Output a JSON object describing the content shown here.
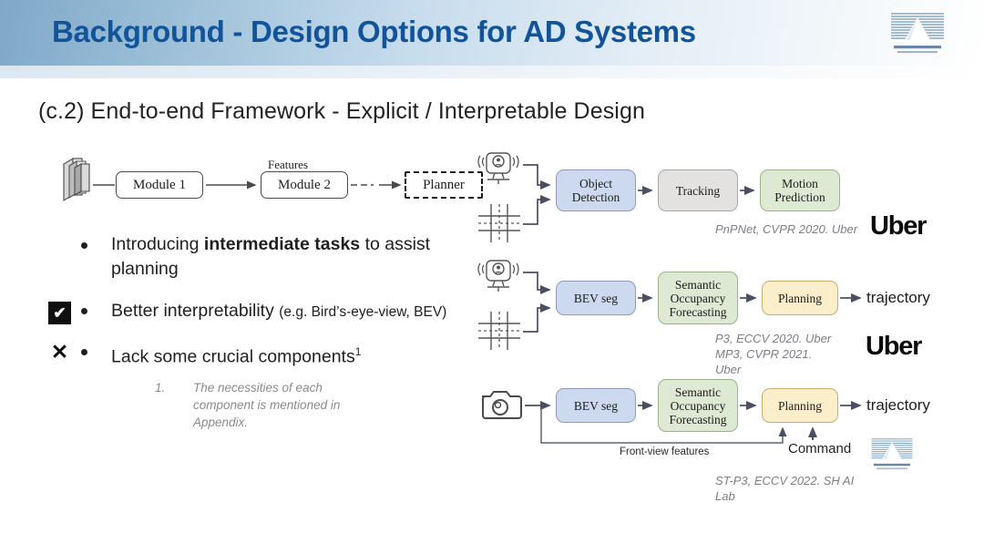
{
  "header": {
    "title": "Background - Design Options for AD Systems",
    "logo_name": "shanghai-ai-laboratory-logo",
    "accent_color": "#12549a"
  },
  "subtitle": "(c.2)  End-to-end Framework -  Explicit / Interpretable Design",
  "module_diagram": {
    "input_icon": "data-stack-icon",
    "module1": "Module 1",
    "features_label": "Features",
    "module2": "Module 2",
    "planner": "Planner"
  },
  "bullets": [
    {
      "marker": "",
      "text_before": "Introducing ",
      "text_bold": "intermediate tasks",
      "text_after": " to assist planning"
    },
    {
      "marker": "✔",
      "text_main": "Better interpretability ",
      "text_small": "(e.g. Bird’s-eye-view, BEV)"
    },
    {
      "marker": "✕",
      "text_main": "Lack some crucial components",
      "superscript": "1"
    }
  ],
  "footnote": {
    "number": "1.",
    "text": "The necessities of each component is mentioned in Appendix."
  },
  "pipelines": [
    {
      "id": "pnpnet",
      "inputs": [
        "lidar-sensor-icon",
        "hd-map-icon"
      ],
      "boxes": [
        {
          "label": "Object Detection",
          "color": "#ccd9ee"
        },
        {
          "label": "Tracking",
          "color": "#e4e2e0"
        },
        {
          "label": "Motion Prediction",
          "color": "#dee9d4"
        }
      ],
      "output": "",
      "caption": "PnPNet, CVPR 2020. Uber",
      "brand": "Uber"
    },
    {
      "id": "p3-mp3",
      "inputs": [
        "lidar-sensor-icon",
        "hd-map-icon"
      ],
      "boxes": [
        {
          "label": "BEV seg",
          "color": "#ccd9ee"
        },
        {
          "label": "Semantic Occupancy Forecasting",
          "color": "#dee9d4"
        },
        {
          "label": "Planning",
          "color": "#fbeecb"
        }
      ],
      "output": "trajectory",
      "caption_line1": "P3, ECCV 2020. Uber",
      "caption_line2": "MP3, CVPR 2021.",
      "caption_line3": "Uber",
      "brand": "Uber"
    },
    {
      "id": "st-p3",
      "inputs": [
        "camera-icon"
      ],
      "boxes": [
        {
          "label": "BEV seg",
          "color": "#ccd9ee"
        },
        {
          "label": "Semantic Occupancy Forecasting",
          "color": "#dee9d4"
        },
        {
          "label": "Planning",
          "color": "#fbeecb"
        }
      ],
      "output": "trajectory",
      "skip_label": "Front-view features",
      "command_label": "Command",
      "caption_line1": "ST-P3, ECCV 2022. SH AI",
      "caption_line2": "Lab",
      "brand_logo": "shanghai-ai-laboratory-logo"
    }
  ],
  "box_labels": {
    "object_detection_l1": "Object",
    "object_detection_l2": "Detection",
    "tracking": "Tracking",
    "motion_prediction_l1": "Motion",
    "motion_prediction_l2": "Prediction",
    "bev_seg": "BEV seg",
    "sof_l1": "Semantic",
    "sof_l2": "Occupancy",
    "sof_l3": "Forecasting",
    "planning": "Planning",
    "trajectory": "trajectory"
  }
}
